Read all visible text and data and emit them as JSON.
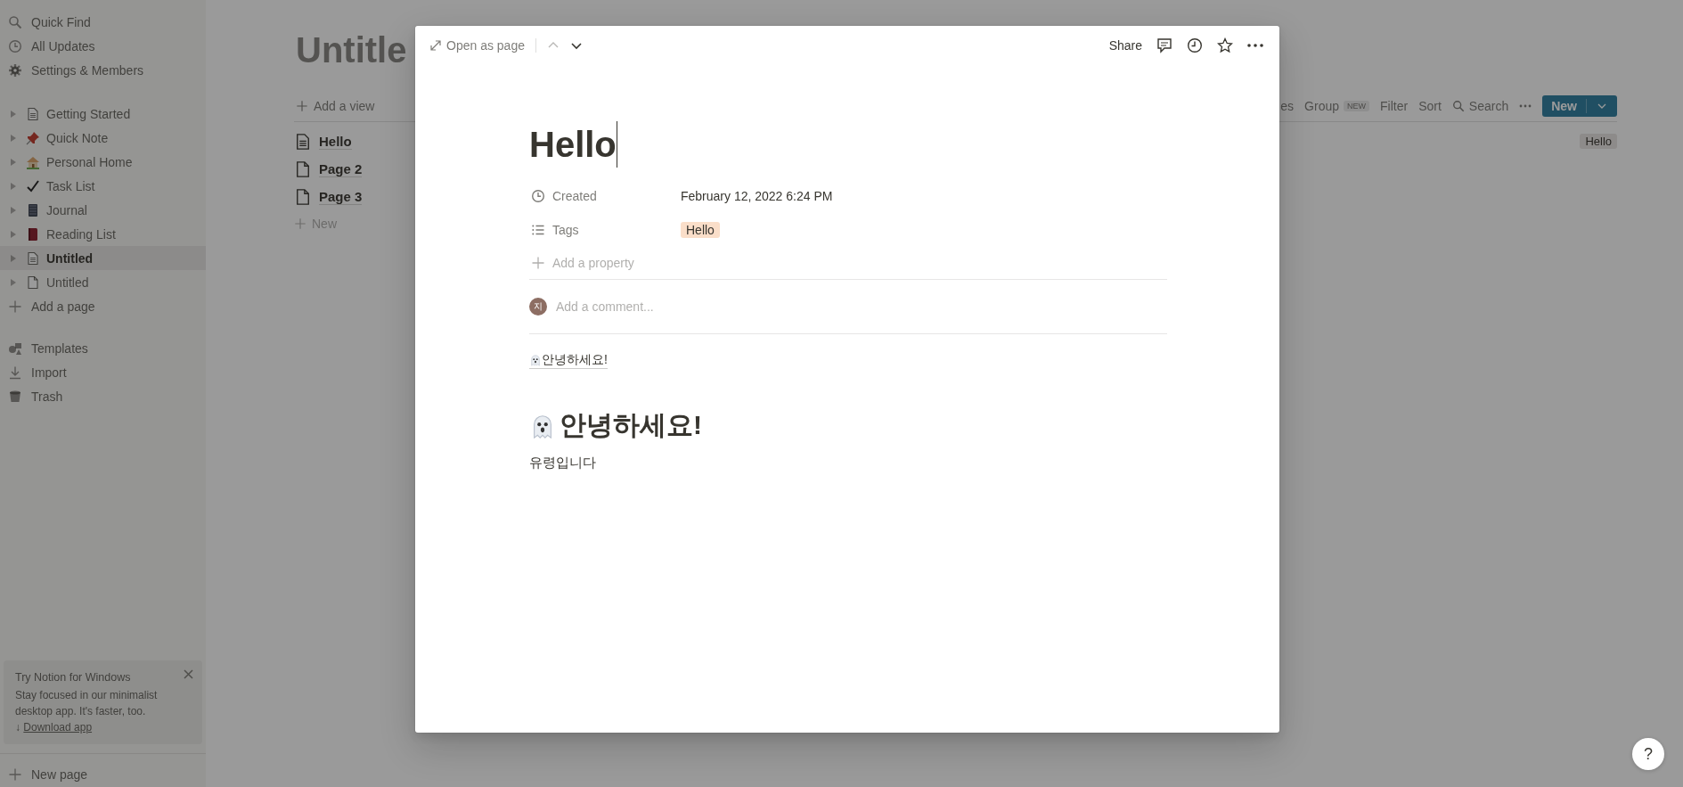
{
  "sidebar": {
    "top_items": [
      {
        "kind": "search",
        "label": "Quick Find"
      },
      {
        "kind": "clock",
        "label": "All Updates"
      },
      {
        "kind": "gear",
        "label": "Settings & Members"
      }
    ],
    "pages": [
      {
        "kind": "doc-lines",
        "label": "Getting Started",
        "selected": false
      },
      {
        "kind": "pin",
        "label": "Quick Note",
        "selected": false
      },
      {
        "kind": "house",
        "label": "Personal Home",
        "selected": false
      },
      {
        "kind": "check",
        "label": "Task List",
        "selected": false
      },
      {
        "kind": "notebook",
        "label": "Journal",
        "selected": false
      },
      {
        "kind": "book",
        "label": "Reading List",
        "selected": false
      },
      {
        "kind": "doc-lines",
        "label": "Untitled",
        "selected": true
      },
      {
        "kind": "doc",
        "label": "Untitled",
        "selected": false
      }
    ],
    "add_page": "Add a page",
    "bottom_items": [
      {
        "kind": "shapes",
        "label": "Templates"
      },
      {
        "kind": "download",
        "label": "Import"
      },
      {
        "kind": "trash",
        "label": "Trash"
      }
    ],
    "promo": {
      "title": "Try Notion for Windows",
      "body": "Stay focused in our minimalist desktop app. It's faster, too.",
      "arrow": "↓",
      "link": "Download app"
    },
    "new_page": "New page"
  },
  "database": {
    "title": "Untitle",
    "add_view": "Add a view",
    "toolbar": {
      "cut_label": "es",
      "group": "Group",
      "group_badge": "NEW",
      "filter": "Filter",
      "sort": "Sort",
      "search": "Search",
      "new": "New"
    },
    "rows": [
      {
        "kind": "doc-lines",
        "title": "Hello",
        "tag": "Hello"
      },
      {
        "kind": "doc",
        "title": "Page 2"
      },
      {
        "kind": "doc",
        "title": "Page 3"
      }
    ],
    "new_row": "New"
  },
  "modal": {
    "open_as_page": "Open as page",
    "share": "Share",
    "title": "Hello",
    "properties": [
      {
        "kind": "clock",
        "label": "Created",
        "value": "February 12, 2022 6:24 PM"
      },
      {
        "kind": "list",
        "label": "Tags",
        "tag": "Hello"
      }
    ],
    "add_property": "Add a property",
    "comment": {
      "avatar": "지",
      "placeholder": "Add a comment..."
    },
    "blocks": [
      {
        "kind": "link",
        "text": "안녕하세요!"
      },
      {
        "kind": "heading",
        "text": "안녕하세요!"
      },
      {
        "kind": "text",
        "text": "유령입니다"
      }
    ]
  },
  "help": "?"
}
